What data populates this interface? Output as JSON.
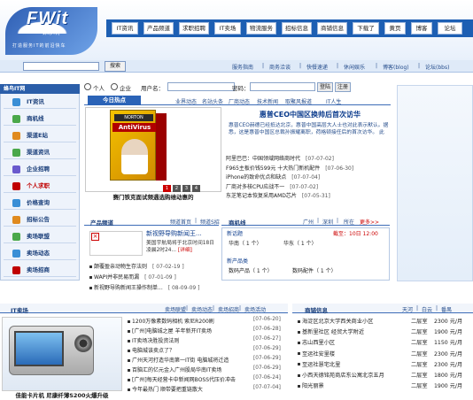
{
  "header": {
    "logo_text": "FWit",
    "logo_sub": "蜂鸟IT网",
    "logo_tag": "打造服务IT的前沿快车",
    "nav": [
      "IT资讯",
      "产品频道",
      "求职招聘",
      "IT卖场",
      "物流服务",
      "招标信息",
      "商铺信息",
      "下载了",
      "黄页",
      "博客",
      "论坛"
    ]
  },
  "subnav": {
    "search_placeholder": "",
    "search_button": "搜索",
    "links": [
      "服务指南",
      "|",
      "商务洽谈",
      "|",
      "快餐速递",
      "|",
      "休闲娱乐",
      "|",
      "博客(blog)",
      "|",
      "论坛(bbs)"
    ]
  },
  "sidebar": {
    "title": "蜂鸟IT网",
    "items": [
      {
        "label": "IT资讯",
        "color": "#3a8fd6"
      },
      {
        "label": "商机线",
        "color": "#4aa84a"
      },
      {
        "label": "渠道E站",
        "color": "#e08a1e"
      },
      {
        "label": "渠道资讯",
        "color": "#4aa84a"
      },
      {
        "label": "企业招聘",
        "color": "#6a5acd"
      },
      {
        "label": "个人求职",
        "color": "#c00000"
      },
      {
        "label": "价格查询",
        "color": "#3a8fd6"
      },
      {
        "label": "招标公告",
        "color": "#e08a1e"
      },
      {
        "label": "卖场联盟",
        "color": "#4aa84a"
      },
      {
        "label": "卖场动态",
        "color": "#3a8fd6"
      },
      {
        "label": "卖场招商",
        "color": "#c00000"
      }
    ]
  },
  "login": {
    "radio_personal": "个人",
    "radio_company": "企业",
    "username_label": "用户名：",
    "password_label": "密码：",
    "login_button": "登陆",
    "register_button": "注册"
  },
  "today": {
    "tab": "今日热点",
    "links": [
      "业界动态",
      "名站头条",
      "厂商动态",
      "技术新闻",
      "取聚风报道",
      "IT人生"
    ],
    "box_brand": "NORTON",
    "box_product": "AntiVirus",
    "caption": "赛门铁克面试频遇选购维动惠的",
    "dots": [
      "1",
      "2",
      "3",
      "4"
    ],
    "feature_title": "惠普CEO中国区换帅后首次访华",
    "feature_desc": "惠普CEO赫德已经抵达北京，惠普中国高层大人士也对此表示默认。据悉，这是惠普中国区总裁孙振耀离职，荷格顿接任后的首次访华。 此",
    "news": [
      {
        "title": "阿里巴巴：中国领域网络商时代",
        "date": "[07-07-02]"
      },
      {
        "title": "F965主板价钱599元 十大热门新机配件",
        "date": "[07-06-30]"
      },
      {
        "title": "iPhone的致命优点和缺点",
        "date": "[07-07-04]"
      },
      {
        "title": "厂商对多核CPU应战不一",
        "date": "[07-07-02]"
      },
      {
        "title": "东芝笔记本恢复采用AMD芯片",
        "date": "[07-05-31]"
      }
    ]
  },
  "product": {
    "title": "产品频道",
    "links": [
      "频道首页",
      "|",
      "频道S招"
    ],
    "headline": "新视野导购新闻王...",
    "desc": "美国宇航局将于北京时间18日凌晨2时24...",
    "detail": "[详细]",
    "list": [
      {
        "title": "颠覆盈亲动物生存法则",
        "date": "[ 07-02-19 ]"
      },
      {
        "title": "WAPI并非民易而漏",
        "date": "[ 07-01-09 ]"
      },
      {
        "title": "新视野导购新闻王操作制单...",
        "date": "[ 08-09-09 ]"
      }
    ]
  },
  "shop": {
    "title": "商机线",
    "links": [
      "广州",
      "|",
      "深圳",
      "|",
      "所在",
      "更多>>"
    ],
    "label_new": "新话题",
    "new_time": "截至：10日 12:00",
    "row1": [
      "华南（ 1 个）",
      "华东（ 1 个）"
    ],
    "label_new2": "新产品类",
    "row2": [
      "数码产品（ 1 个）",
      "数码配件（ 1 个）"
    ]
  },
  "it_market": {
    "title": "IT卖场",
    "links": [
      "卖场联盟",
      "|",
      "卖场动态",
      "|",
      "卖场招商",
      "|",
      "卖场活动"
    ],
    "caption": "佳能卡片机 尼康纤薄S200火爆升级",
    "news": [
      {
        "title": "1200万像素数码相机 索尼R200刷",
        "date": "[07-06-20]"
      },
      {
        "title": "[广州]电脑城之屋 羊年新开IT卖场",
        "date": "[07-06-28]"
      },
      {
        "title": "IT卖场决胜投资法则",
        "date": "[07-06-27]"
      },
      {
        "title": "电脑城该卖点了？",
        "date": "[07-06-29]"
      },
      {
        "title": "广州天河打造华南第一IT街 电脑城将迁造",
        "date": "[07-06-29]"
      },
      {
        "title": "百脑汇的亿元金入广州股局华南IT卖场",
        "date": "[07-06-29]"
      },
      {
        "title": "[广州]每天经营卡中新闻网BOSS代压价冲击",
        "date": "[07-06-24]"
      },
      {
        "title": "今年最热门 顺带要把重链散大",
        "date": "[07-07-04]"
      }
    ]
  },
  "market": {
    "title": "商铺信息",
    "links": [
      "天河",
      "|",
      "白云",
      "|",
      "番禺"
    ],
    "rows": [
      {
        "name": "海淀区北京大学西关商业小区",
        "floor": "二层室",
        "price": "2300 元/月"
      },
      {
        "name": "基新里社区 经贸大学附近",
        "floor": "二层室",
        "price": "1900 元/月"
      },
      {
        "name": "志山西里小区",
        "floor": "二层室",
        "price": "1150 元/月"
      },
      {
        "name": "至运社安里楼",
        "floor": "二层室",
        "price": "2300 元/月"
      },
      {
        "name": "至运社慧宅北里",
        "floor": "二层室",
        "price": "2300 元/月"
      },
      {
        "name": "小西天德铭苑商店东公寓北京五月",
        "floor": "二层室",
        "price": "1800 元/月"
      },
      {
        "name": "阳光丽景",
        "floor": "二层室",
        "price": "1900 元/月"
      }
    ]
  }
}
